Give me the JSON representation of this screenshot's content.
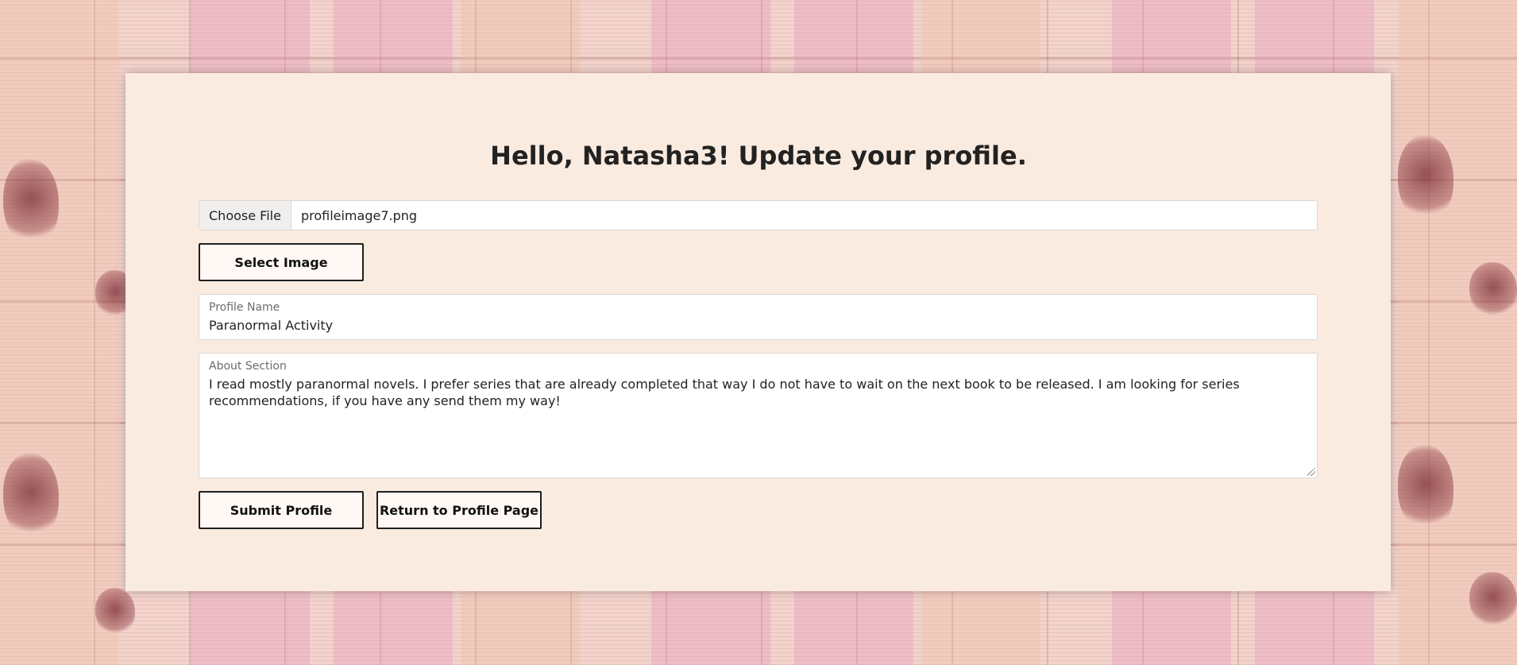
{
  "page": {
    "title": "Hello, Natasha3! Update your profile."
  },
  "file_picker": {
    "button_label": "Choose File",
    "file_name": "profileimage7.png"
  },
  "select_image_button": "Select Image",
  "profile_name": {
    "label": "Profile Name",
    "value": "Paranormal Activity"
  },
  "about_section": {
    "label": "About Section",
    "value": "I read mostly paranormal novels. I prefer series that are already completed that way I do not have to wait on the next book to be released. I am looking for series recommendations, if you have any send them my way!"
  },
  "actions": {
    "submit_label": "Submit Profile",
    "return_label": "Return to Profile Page"
  }
}
